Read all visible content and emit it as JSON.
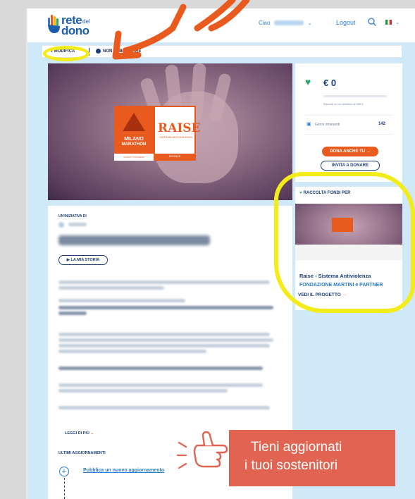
{
  "header": {
    "logo": {
      "line1": "rete",
      "small": "del",
      "line2": "dono"
    },
    "greeting": "Ciao",
    "user_name": "Claudio Bersani",
    "logout": "Logout",
    "lang": "IT"
  },
  "toolbar": {
    "edit_label": "MODIFICA",
    "unpublish_label": "NON PUBBLICARE"
  },
  "donation": {
    "amount": "€ 0",
    "progress_fraction": 0,
    "goal_text": "Raccolti su un obiettivo di 200 €",
    "days_label": "Giorni rimanenti",
    "days_value": "142",
    "donate_button": "DONA ANCHE TU",
    "invite_button": "INVITA A DONARE"
  },
  "hero_badge": {
    "left_line1": "MILANO",
    "left_line2": "MARATHON",
    "left_line3": "CHARITY PROGRAM",
    "right_line1": "RAISE",
    "right_line2": "SISTEMA ANTIVIOLENZA",
    "right_line3": "BRONZE"
  },
  "fundraise_for": {
    "heading": "RACCOLTA FONDI PER",
    "project_title": "Raise - Sistema Antiviolenza",
    "partner": "FONDAZIONE MARTINI e PARTNER",
    "link": "VEDI IL PROGETTO"
  },
  "main": {
    "initiative_label": "UN'INIZIATIVA DI",
    "story_button": "LA MIA STORIA",
    "read_more": "LEGGI DI PIÙ",
    "updates_heading": "ULTIMI AGGIORNAMENTI",
    "publish_update": "Pubblica un nuovo aggiornamento"
  },
  "callout": {
    "line1": "Tieni aggiornati",
    "line2": "i tuoi sostenitori"
  },
  "colors": {
    "brand_blue": "#1c5ea8",
    "accent_orange": "#e85a1e",
    "highlight_yellow": "#f3ec1a",
    "callout_red": "#e06451",
    "page_bg": "#cfe9f8"
  }
}
